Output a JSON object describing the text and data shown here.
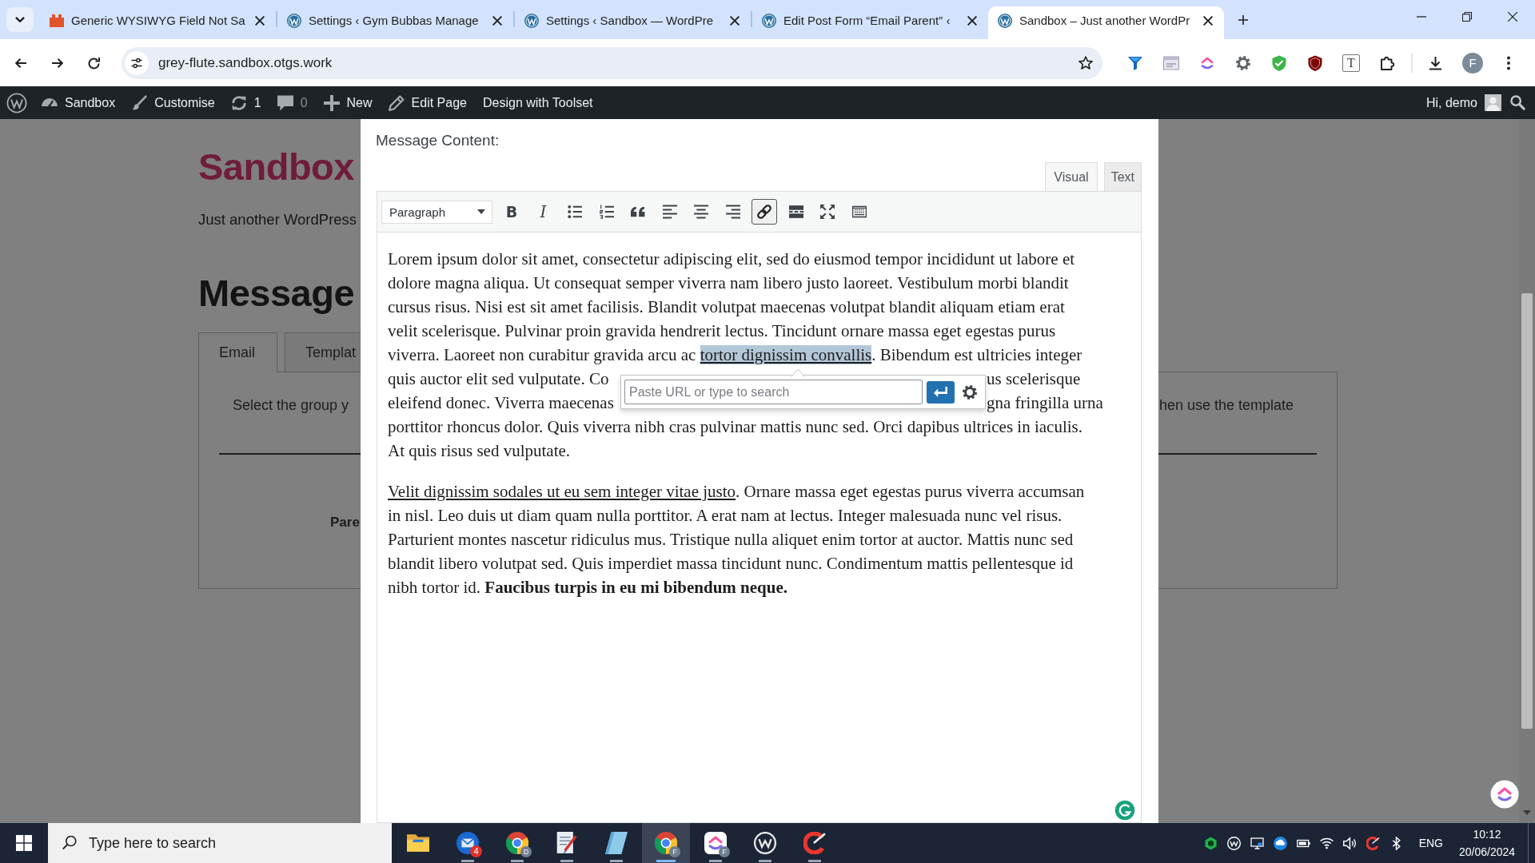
{
  "browser": {
    "tabs": [
      {
        "title": "Generic WYSIWYG Field Not Sa",
        "kind": "plugin",
        "selected": false
      },
      {
        "title": "Settings ‹ Gym Bubbas Manage",
        "kind": "wordpress",
        "selected": false
      },
      {
        "title": "Settings ‹ Sandbox — WordPre",
        "kind": "wordpress",
        "selected": false
      },
      {
        "title": "Edit Post Form “Email Parent” ‹",
        "kind": "wordpress",
        "selected": false
      },
      {
        "title": "Sandbox – Just another WordPr",
        "kind": "wordpress",
        "selected": true
      }
    ],
    "address": "grey-flute.sandbox.otgs.work",
    "extensions": [
      {
        "kind": "funnel"
      },
      {
        "kind": "php"
      },
      {
        "kind": "clickup"
      },
      {
        "kind": "gear"
      },
      {
        "kind": "shield"
      },
      {
        "kind": "ublock"
      },
      {
        "kind": "letter",
        "label": "T"
      },
      {
        "kind": "puzzle"
      }
    ],
    "profile_initial": "F"
  },
  "admin_bar": {
    "items": [
      {
        "kind": "logo"
      },
      {
        "kind": "site",
        "label": "Sandbox"
      },
      {
        "kind": "customise",
        "label": "Customise"
      },
      {
        "kind": "updates",
        "label": "1"
      },
      {
        "kind": "comments",
        "label": "0"
      },
      {
        "kind": "new",
        "label": "New"
      },
      {
        "kind": "edit",
        "label": "Edit Page"
      },
      {
        "kind": "plain",
        "label": "Design with Toolset"
      }
    ],
    "greeting": "Hi, demo"
  },
  "page": {
    "site_title": "Sandbox",
    "tagline": "Just another WordPress",
    "heading": "Message",
    "tabs": [
      {
        "label": "Email",
        "selected": true
      },
      {
        "label": "Templat",
        "selected": false
      }
    ],
    "panel": {
      "text_left": "Select the group y",
      "text_right": "hen use the template",
      "field_label": "Pare"
    }
  },
  "modal": {
    "label": "Message Content:",
    "editor_tabs": [
      {
        "label": "Visual",
        "selected": true
      },
      {
        "label": "Text",
        "selected": false
      }
    ],
    "format": "Paragraph",
    "toolbar": [
      {
        "kind": "bold",
        "glyph": "B",
        "active": false
      },
      {
        "kind": "italic",
        "glyph": "I",
        "active": false
      },
      {
        "kind": "bullets",
        "active": false
      },
      {
        "kind": "numbers",
        "active": false
      },
      {
        "kind": "quote",
        "active": false
      },
      {
        "kind": "align-left",
        "active": false
      },
      {
        "kind": "align-center",
        "active": false
      },
      {
        "kind": "align-right",
        "active": false
      },
      {
        "kind": "link",
        "active": true
      },
      {
        "kind": "more",
        "active": false
      },
      {
        "kind": "fullscreen",
        "active": false
      },
      {
        "kind": "toggle",
        "active": false
      }
    ],
    "paragraphs": [
      {
        "lines": [
          {
            "kind": "full",
            "segments": [
              {
                "kind": "text",
                "text": "Lorem ipsum dolor sit amet, consectetur adipiscing elit, sed do eiusmod tempor incididunt ut labore et"
              }
            ]
          },
          {
            "kind": "full",
            "segments": [
              {
                "kind": "text",
                "text": "dolore magna aliqua. Ut consequat semper viverra nam libero justo laoreet. Vestibulum morbi blandit"
              }
            ]
          },
          {
            "kind": "full",
            "segments": [
              {
                "kind": "text",
                "text": "cursus risus. Nisi est sit amet facilisis. Blandit volutpat maecenas volutpat blandit aliquam etiam erat"
              }
            ]
          },
          {
            "kind": "full",
            "segments": [
              {
                "kind": "text",
                "text": "velit scelerisque. Pulvinar proin gravida hendrerit lectus. Tincidunt ornare massa eget egestas purus"
              }
            ]
          },
          {
            "kind": "full",
            "segments": [
              {
                "kind": "text",
                "text": "viverra. Laoreet non curabitur gravida arcu ac "
              },
              {
                "kind": "link",
                "text": "tortor dignissim convallis",
                "selected": true
              },
              {
                "kind": "text",
                "text": ". Bibendum est ultricies integer"
              }
            ]
          },
          {
            "kind": "covered",
            "before": "quis auctor elit sed vulputate. Co",
            "after": "us scelerisque"
          },
          {
            "kind": "covered",
            "before": "eleifend donec. Viverra maecenas",
            "after": "gna fringilla urna"
          },
          {
            "kind": "full",
            "segments": [
              {
                "kind": "text",
                "text": "porttitor rhoncus dolor. Quis viverra nibh cras pulvinar mattis nunc sed. Orci dapibus ultrices in iaculis."
              }
            ]
          },
          {
            "kind": "full",
            "segments": [
              {
                "kind": "text",
                "text": "At quis risus sed vulputate."
              }
            ]
          }
        ]
      },
      {
        "lines": [
          {
            "kind": "full",
            "segments": [
              {
                "kind": "link",
                "text": "Velit dignissim sodales ut eu sem integer vitae justo",
                "selected": false
              },
              {
                "kind": "text",
                "text": ". Ornare massa eget egestas purus viverra accumsan"
              }
            ]
          },
          {
            "kind": "full",
            "segments": [
              {
                "kind": "text",
                "text": "in nisl. Leo duis ut diam quam nulla porttitor. A erat nam at lectus. Integer malesuada nunc vel risus."
              }
            ]
          },
          {
            "kind": "full",
            "segments": [
              {
                "kind": "text",
                "text": "Parturient montes nascetur ridiculus mus. Tristique nulla aliquet enim tortor at auctor. Mattis nunc sed"
              }
            ]
          },
          {
            "kind": "full",
            "segments": [
              {
                "kind": "text",
                "text": "blandit libero volutpat sed. Quis imperdiet massa tincidunt nunc. Condimentum mattis pellentesque id"
              }
            ]
          },
          {
            "kind": "full",
            "segments": [
              {
                "kind": "text",
                "text": "nibh tortor id. **Faucibus turpis in eu mi bibendum neque.**"
              }
            ]
          }
        ]
      }
    ],
    "link_popup": {
      "placeholder": "Paste URL or type to search"
    }
  },
  "taskbar": {
    "search_placeholder": "Type here to search",
    "apps": [
      {
        "kind": "folder",
        "running": false,
        "selected": false
      },
      {
        "kind": "mail",
        "badge": "4",
        "running": true,
        "selected": false
      },
      {
        "kind": "browser",
        "badge": "D",
        "running": true,
        "selected": false
      },
      {
        "kind": "document",
        "running": true,
        "selected": false
      },
      {
        "kind": "notes",
        "running": true,
        "selected": false
      },
      {
        "kind": "browser",
        "badge": "F",
        "running": true,
        "selected": true
      },
      {
        "kind": "clickup",
        "badge": "F",
        "running": true,
        "selected": false
      },
      {
        "kind": "w",
        "running": true,
        "selected": false
      },
      {
        "kind": "cleaner",
        "running": true,
        "selected": false
      }
    ],
    "tray": {
      "icons": [
        {
          "kind": "hexagon"
        },
        {
          "kind": "w"
        },
        {
          "kind": "monitor"
        },
        {
          "kind": "cloud"
        },
        {
          "kind": "battery"
        },
        {
          "kind": "wifi"
        },
        {
          "kind": "speaker"
        },
        {
          "kind": "cleaner"
        },
        {
          "kind": "bluetooth"
        }
      ],
      "language": "ENG",
      "time": "10:12",
      "date": "20/06/2024"
    }
  }
}
